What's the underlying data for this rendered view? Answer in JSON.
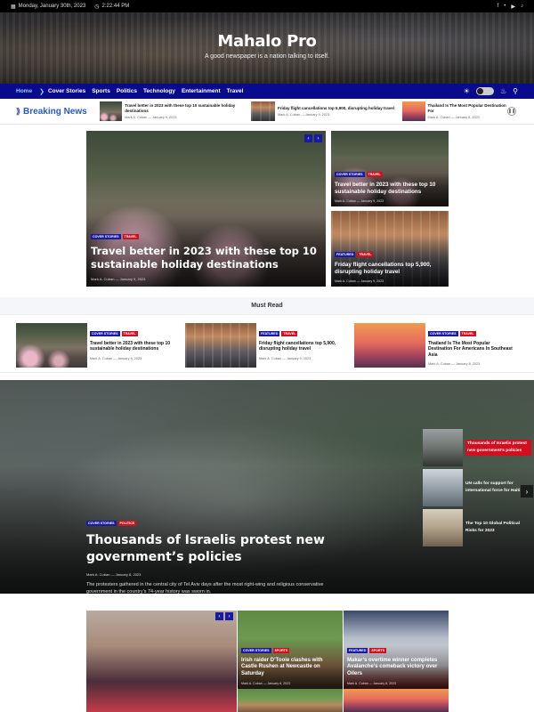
{
  "topbar": {
    "date": "Monday, January 30th, 2023",
    "time": "2:22:44 PM",
    "social": [
      "f",
      "•",
      "▶",
      "♪"
    ]
  },
  "header": {
    "title": "Mahalo Pro",
    "tagline": "A good newspaper is a nation talking to itself."
  },
  "nav": {
    "items": [
      "Home",
      "Cover Stories",
      "Sports",
      "Politics",
      "Technology",
      "Entertainment",
      "Travel"
    ]
  },
  "breaking": {
    "label": "Breaking News",
    "items": [
      {
        "title": "Travel better in 2023 with these top 10 sustainable holiday destinations",
        "meta": "Mark A. Cuban — January 9, 2023"
      },
      {
        "title": "Friday flight cancellations top 5,900, disrupting holiday travel",
        "meta": "Mark A. Cuban — January 9, 2023"
      },
      {
        "title": "Thailand Is The Most Popular Destination For",
        "meta": "Mark A. Cuban — January 8, 2023"
      }
    ]
  },
  "hero": {
    "main": {
      "tags": [
        "Cover Stories",
        "Travel"
      ],
      "title": "Travel better in 2023 with these top 10 sustainable holiday destinations",
      "meta": "Mark A. Cuban — January 9, 2023"
    },
    "side": [
      {
        "tags": [
          "Cover Stories",
          "Travel"
        ],
        "title": "Travel better in 2023 with these top 10 sustainable holiday destinations",
        "meta": "Mark A. Cuban — January 9, 2023"
      },
      {
        "tags": [
          "Featured",
          "Travel"
        ],
        "title": "Friday flight cancellations top 5,900, disrupting holiday travel",
        "meta": "Mark A. Cuban — January 9, 2023"
      }
    ]
  },
  "must_read": {
    "heading": "Must Read",
    "items": [
      {
        "tags": [
          "Cover Stories",
          "Travel"
        ],
        "title": "Travel better in 2023 with these top 10 sustainable holiday destinations",
        "meta": "Mark A. Cuban — January 9, 2023"
      },
      {
        "tags": [
          "Featured",
          "Travel"
        ],
        "title": "Friday flight cancellations top 5,900, disrupting holiday travel",
        "meta": "Mark A. Cuban — January 9, 2023"
      },
      {
        "tags": [
          "Cover Stories",
          "Travel"
        ],
        "title": "Thailand Is The Most Popular Destination For Americans In Southeast Asia",
        "meta": "Mark A. Cuban — January 8, 2023"
      }
    ]
  },
  "feature": {
    "tags": [
      "Cover Stories",
      "Politics"
    ],
    "title": "Thousands of Israelis protest new government’s policies",
    "meta": "Mark A. Cuban — January 8, 2023",
    "excerpt": "The protesters gathered in the central city of Tel Aviv days after the most right-wing and religious conservative government in the country’s 74-year history was sworn in.",
    "side": [
      {
        "title": "Thousands of Israelis protest new government’s policies"
      },
      {
        "title": "UN calls for support for international force for Haiti"
      },
      {
        "title": "The Top 10 Global Political Risks for 2023"
      }
    ]
  },
  "bottom": {
    "cards": [
      {
        "tags": [
          "Cover Stories",
          "Sports"
        ],
        "title": "Irish raider D’Tooie clashes with Castle Rushen at Newcastle on Saturday",
        "meta": "Mark A. Cuban — January 8, 2023"
      },
      {
        "tags": [
          "Featured",
          "Sports"
        ],
        "title": "Makar’s overtime winner completes Avalanche’s comeback victory over Oilers",
        "meta": "Mark A. Cuban — January 8, 2023"
      }
    ]
  },
  "colors": {
    "nav": "#0a0a8c",
    "accent_red": "#d10f1f",
    "tag_blue": "#1a1aa0",
    "breaking_blue": "#2a57c7"
  }
}
